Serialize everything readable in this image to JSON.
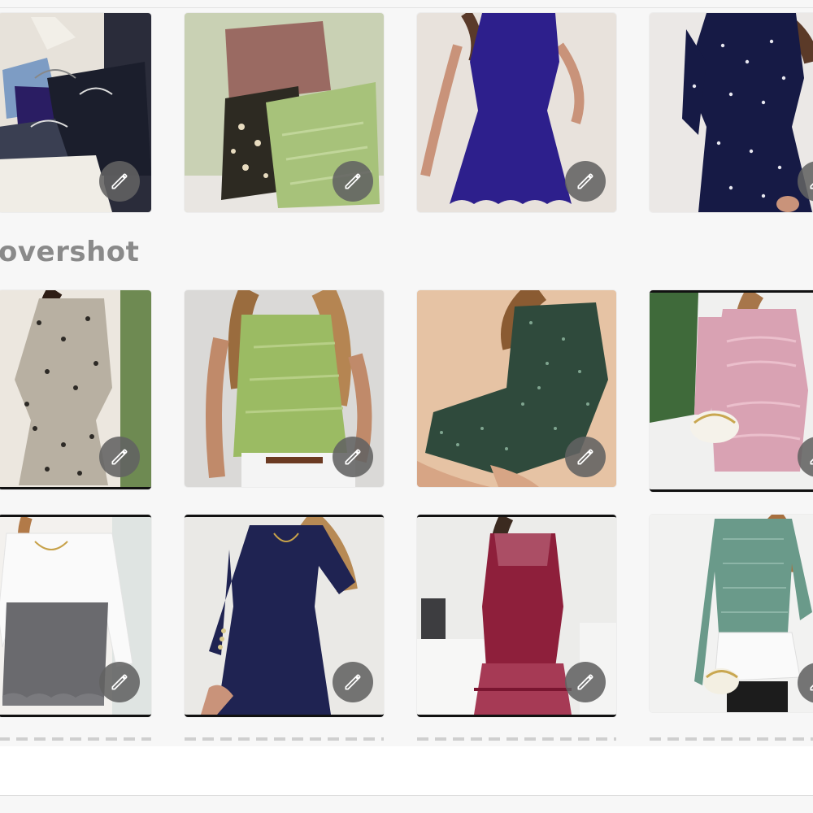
{
  "section": {
    "title": "overshot"
  },
  "colors": {
    "page_background": "#f7f7f7",
    "edit_button": "#626262",
    "title_text": "#8a8a8a"
  },
  "items": [
    {
      "subject": "clothes-on-hangers",
      "edit_icon": "pencil-icon"
    },
    {
      "subject": "folded-clothes-basket",
      "edit_icon": "pencil-icon"
    },
    {
      "subject": "blue-scalloped-dress",
      "edit_icon": "pencil-icon"
    },
    {
      "subject": "navy-pearl-dress",
      "edit_icon": "pencil-icon"
    },
    {
      "subject": "floral-wrap-dress",
      "edit_icon": "pencil-icon"
    },
    {
      "subject": "green-lace-top",
      "edit_icon": "pencil-icon"
    },
    {
      "subject": "green-speckled-dress",
      "edit_icon": "pencil-icon"
    },
    {
      "subject": "pink-knit-dress",
      "edit_icon": "pencil-icon"
    },
    {
      "subject": "white-blouse-grey-skirt",
      "edit_icon": "pencil-icon"
    },
    {
      "subject": "navy-button-cuff-dress",
      "edit_icon": "pencil-icon"
    },
    {
      "subject": "burgundy-mesh-dress",
      "edit_icon": "pencil-icon"
    },
    {
      "subject": "green-knit-layered-top",
      "edit_icon": "pencil-icon"
    }
  ]
}
